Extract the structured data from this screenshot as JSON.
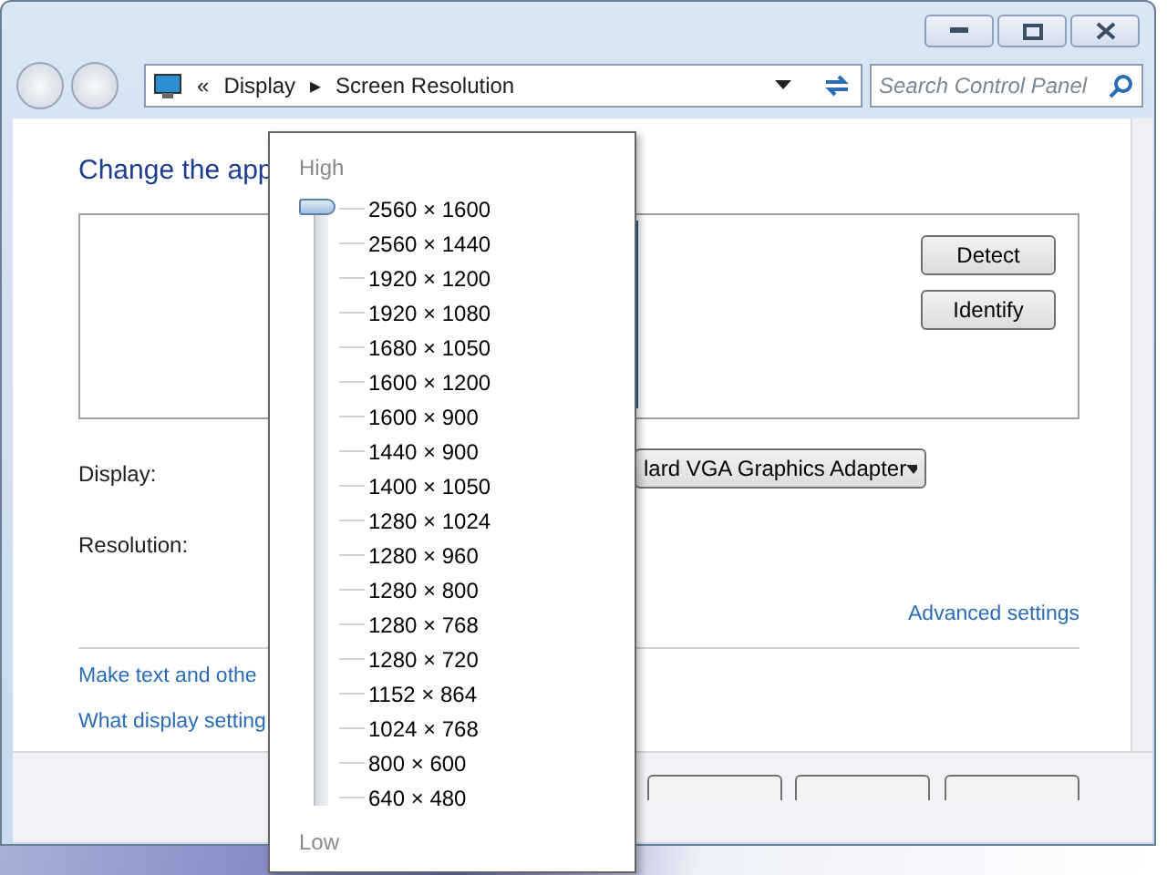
{
  "address_bar": {
    "chevron": "«",
    "crumbs": [
      "Display",
      "Screen Resolution"
    ],
    "separator": "▸"
  },
  "search": {
    "placeholder": "Search Control Panel"
  },
  "heading": "Change the app",
  "buttons": [
    "Detect",
    "Identify"
  ],
  "display": {
    "label": "Display:",
    "value": "lard VGA Graphics Adapter"
  },
  "resolution": {
    "label": "Resolution:"
  },
  "advanced_link": "Advanced settings",
  "links": [
    "Make text and othe",
    "What display setting"
  ],
  "popup": {
    "high": "High",
    "low": "Low",
    "level": 1,
    "options": [
      "2560 × 1600",
      "2560 × 1440",
      "1920 × 1200",
      "1920 × 1080",
      "1680 × 1050",
      "1600 × 1200",
      "1600 × 900",
      "1440 × 900",
      "1400 × 1050",
      "1280 × 1024",
      "1280 × 960",
      "1280 × 800",
      "1280 × 768",
      "1280 × 720",
      "1152 × 864",
      "1024 × 768",
      "800 × 600",
      "640 × 480"
    ]
  }
}
